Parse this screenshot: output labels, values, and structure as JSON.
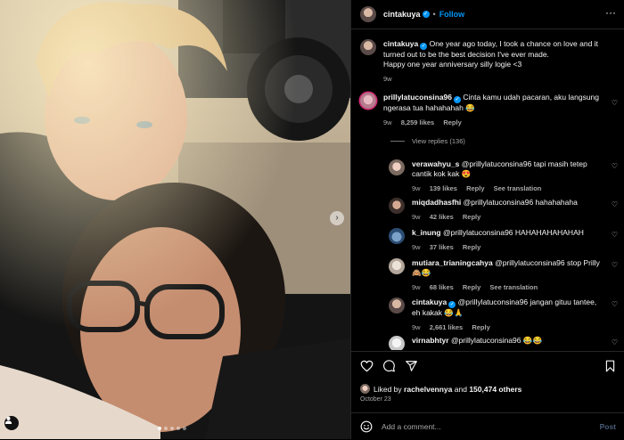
{
  "header": {
    "username": "cintakuya",
    "separator": "•",
    "follow_label": "Follow",
    "more_icon": "ellipsis-icon"
  },
  "caption": {
    "username": "cintakuya",
    "text": "One year ago today, I took a chance on love and it turned out to be the best decision I've ever made.",
    "text2": "Happy one year anniversary silly logie <3",
    "age": "9w"
  },
  "comments": [
    {
      "username": "prillylatuconsina96",
      "verified": true,
      "text": "Cinta kamu udah pacaran, aku langsung ngerasa tua hahahahah 😂",
      "age": "9w",
      "likes": "8,259 likes",
      "reply": "Reply",
      "view_replies": "View replies (136)"
    }
  ],
  "replies": [
    {
      "username": "verawahyu_s",
      "text": "@prillylatuconsina96 tapi masih tetep cantik kok kak 😍",
      "age": "9w",
      "likes": "139 likes",
      "reply": "Reply",
      "translation": "See translation"
    },
    {
      "username": "miqdadhasfhi",
      "text": "@prillylatuconsina96 hahahahaha",
      "age": "9w",
      "likes": "42 likes",
      "reply": "Reply"
    },
    {
      "username": "k_inung",
      "text": "@prillylatuconsina96 HAHAHAHAHAHAH",
      "age": "9w",
      "likes": "37 likes",
      "reply": "Reply"
    },
    {
      "username": "mutiara_trianingcahya",
      "text": "@prillylatuconsina96 stop Prilly 🙈😂",
      "age": "9w",
      "likes": "68 likes",
      "reply": "Reply",
      "translation": "See translation"
    },
    {
      "username": "cintakuya",
      "verified": true,
      "text": "@prillylatuconsina96 jangan gituu tantee, eh kakak 😂🙏",
      "age": "9w",
      "likes": "2,661 likes",
      "reply": "Reply"
    },
    {
      "username": "virnabhtyr",
      "text": "@prillylatuconsina96 😂😂"
    }
  ],
  "actions": {
    "liked_by_prefix": "Liked by",
    "liked_by_user": "rachelvennya",
    "liked_by_and": "and",
    "liked_by_others": "150,474 others",
    "date": "October 23",
    "comment_placeholder": "Add a comment...",
    "post_label": "Post"
  },
  "media": {
    "carousel_dots": 5,
    "active_dot": 0
  },
  "colors": {
    "accent": "#0095f6",
    "background": "#000000",
    "secondary_text": "#a8a8a8",
    "divider": "#262626"
  }
}
